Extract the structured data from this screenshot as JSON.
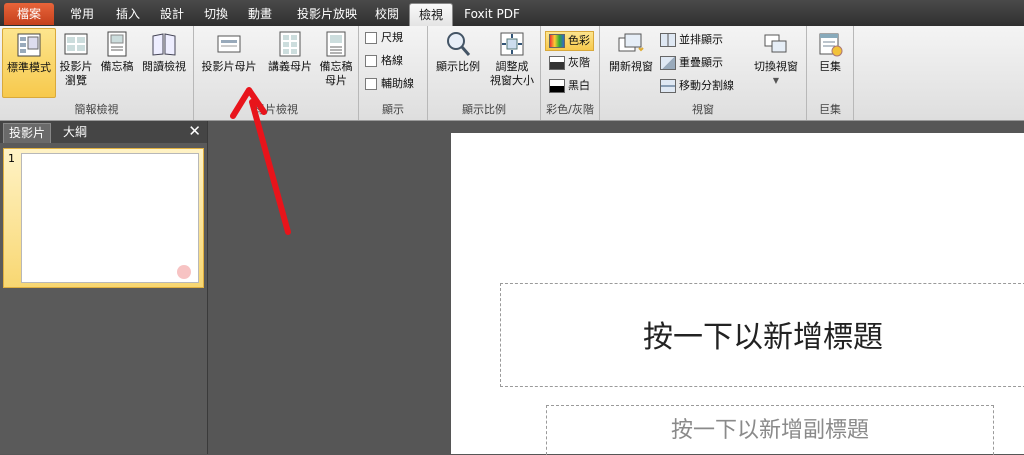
{
  "tabs": [
    "檔案",
    "常用",
    "插入",
    "設計",
    "切換",
    "動畫",
    "投影片放映",
    "校閱",
    "檢視",
    "Foxit PDF"
  ],
  "ribbon": {
    "presentation_views": {
      "label": "簡報檢視",
      "normal": "標準模式",
      "sorter_line1": "投影片",
      "sorter_line2": "瀏覽",
      "notes": "備忘稿",
      "reading": "閱讀檢視"
    },
    "master_views": {
      "label": "母片檢視",
      "slide_master": "投影片母片",
      "handout_master": "講義母片",
      "notes_master_line1": "備忘稿",
      "notes_master_line2": "母片"
    },
    "show": {
      "label": "顯示",
      "ruler": "尺規",
      "gridlines": "格線",
      "guides": "輔助線"
    },
    "zoom": {
      "label": "顯示比例",
      "zoom": "顯示比例",
      "fit_line1": "調整成",
      "fit_line2": "視窗大小"
    },
    "color": {
      "label": "彩色/灰階",
      "color": "色彩",
      "grayscale": "灰階",
      "bw": "黑白"
    },
    "window": {
      "label": "視窗",
      "new_window": "開新視窗",
      "arrange_all": "並排顯示",
      "cascade": "重疊顯示",
      "move_split": "移動分割線",
      "switch_windows": "切換視窗"
    },
    "macros": {
      "label": "巨集",
      "macros": "巨集"
    }
  },
  "pane": {
    "tab_slides": "投影片",
    "tab_outline": "大綱",
    "close_glyph": "✕",
    "slide_number": "1"
  },
  "slide": {
    "title_placeholder": "按一下以新增標題",
    "subtitle_placeholder": "按一下以新增副標題"
  },
  "colors": {
    "file_tab": "#d65a2e",
    "selected_button": "#f7c94c",
    "annotation_arrow": "#e8141b"
  }
}
